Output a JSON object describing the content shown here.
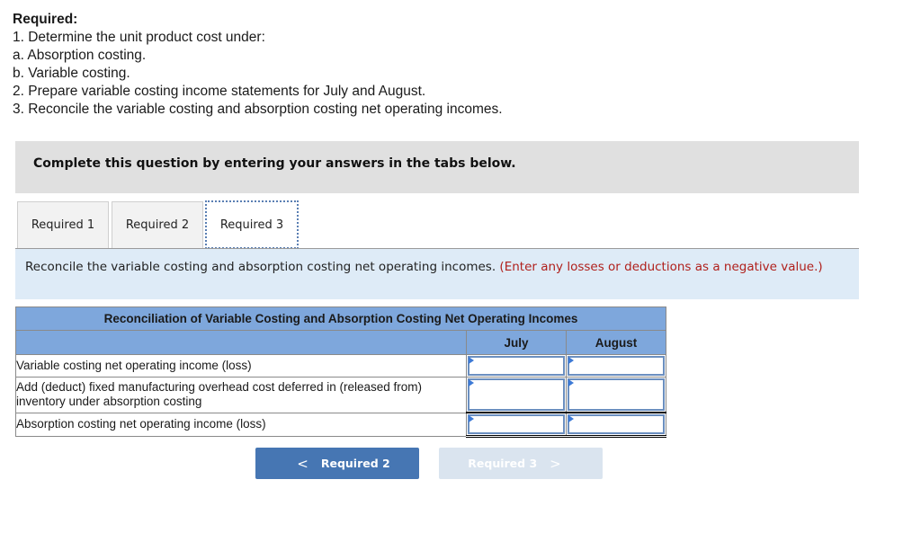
{
  "requirements": {
    "title": "Required:",
    "items": [
      "1. Determine the unit product cost under:",
      "a. Absorption costing.",
      "b. Variable costing.",
      "2. Prepare variable costing income statements for July and August.",
      "3. Reconcile the variable costing and absorption costing net operating incomes."
    ]
  },
  "instruction_bar": "Complete this question by entering your answers in the tabs below.",
  "tabs": [
    {
      "label": "Required 1",
      "active": false
    },
    {
      "label": "Required 2",
      "active": false
    },
    {
      "label": "Required 3",
      "active": true
    }
  ],
  "prompt": {
    "text": "Reconcile the variable costing and absorption costing net operating incomes.",
    "note": "(Enter any losses or deductions as a negative value.)"
  },
  "table": {
    "caption": "Reconciliation of Variable Costing and Absorption Costing Net Operating Incomes",
    "columns": [
      "July",
      "August"
    ],
    "rows": [
      {
        "label": "Variable costing net operating income (loss)",
        "july": "",
        "august": ""
      },
      {
        "label": "Add (deduct) fixed manufacturing overhead cost deferred in (released from) inventory under absorption costing",
        "july": "",
        "august": ""
      },
      {
        "label": "Absorption costing net operating income (loss)",
        "july": "",
        "august": ""
      }
    ]
  },
  "nav": {
    "prev_label": "Required 2",
    "prev_icon": "chevron-left",
    "next_label": "Required 3",
    "next_icon": "chevron-right",
    "next_disabled": true
  },
  "colors": {
    "table_header": "#7ea7dc",
    "prompt_bg": "#deebf7",
    "note_red": "#b0201c",
    "prev_button": "#4676b3",
    "next_button_disabled": "#dae4ef"
  }
}
